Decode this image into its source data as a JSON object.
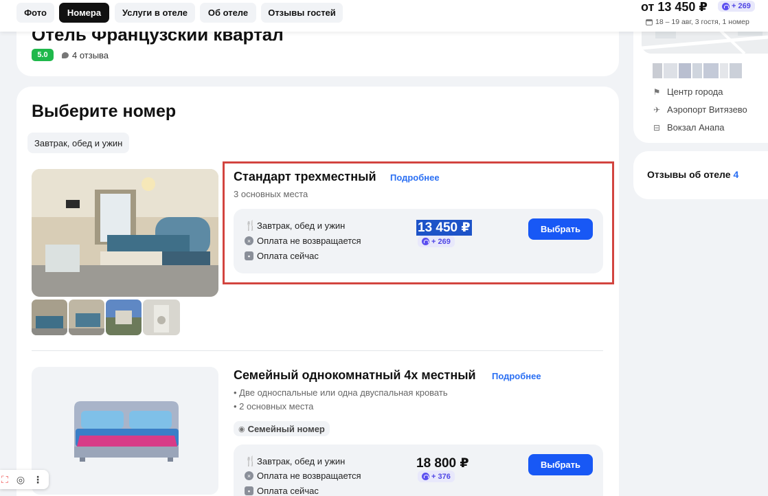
{
  "nav": {
    "tabs": [
      {
        "label": "Фото",
        "active": false
      },
      {
        "label": "Номера",
        "active": true
      },
      {
        "label": "Услуги в отеле",
        "active": false
      },
      {
        "label": "Об отеле",
        "active": false
      },
      {
        "label": "Отзывы гостей",
        "active": false
      }
    ],
    "price_from": "от 13 450 ₽",
    "bonus": "+ 269",
    "dates": "18 – 19 авг, 3 гостя, 1 номер"
  },
  "hotel": {
    "title": "Отель Французский квартал",
    "rating": "5.0",
    "reviews": "4 отзыва"
  },
  "rooms_section": {
    "title": "Выберите номер",
    "filter_chip": "Завтрак, обед и ужин"
  },
  "rooms": [
    {
      "name": "Стандарт трехместный",
      "more_link": "Подробнее",
      "details": [
        "3 основных места"
      ],
      "tariff": {
        "meal": "Завтрак, обед и ужин",
        "refund": "Оплата не возвращается",
        "payment": "Оплата сейчас",
        "price": "13 450 ₽",
        "bonus": "+ 269",
        "button": "Выбрать"
      }
    },
    {
      "name": "Семейный однокомнатный 4х местный",
      "more_link": "Подробнее",
      "details": [
        "• Две односпальные или одна двуспальная кровать",
        "• 2 основных места"
      ],
      "tag": "Семейный номер",
      "tariff": {
        "meal": "Завтрак, обед и ужин",
        "refund": "Оплата не возвращается",
        "payment": "Оплата сейчас",
        "price": "18 800 ₽",
        "bonus": "+ 376",
        "button": "Выбрать"
      }
    }
  ],
  "sidebar": {
    "places": [
      {
        "icon": "flag-icon",
        "label": "Центр города"
      },
      {
        "icon": "airplane-icon",
        "label": "Аэропорт Витязево"
      },
      {
        "icon": "train-icon",
        "label": "Вокзал Анапа"
      }
    ],
    "reviews_label": "Отзывы об отеле",
    "reviews_count": "4"
  },
  "colors": {
    "accent": "#1858f5",
    "rating_green": "#1fb84b",
    "bonus_purple": "#5b4ff0",
    "highlight_red": "#d2443f"
  }
}
